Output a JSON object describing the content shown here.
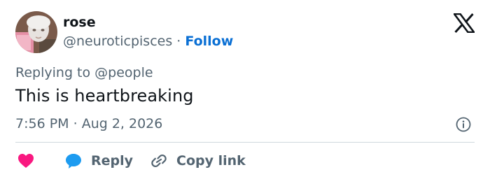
{
  "author": {
    "name": "rose",
    "handle": "@neuroticpisces",
    "separator": "·",
    "follow_label": "Follow"
  },
  "reply": {
    "prefix": "Replying to",
    "mention": "@people"
  },
  "tweet": {
    "text": "This is heartbreaking",
    "time": "7:56 PM",
    "date": "Aug 2, 2026"
  },
  "actions": {
    "reply_label": "Reply",
    "copy_label": "Copy link"
  },
  "icons": {
    "brand": "x-logo-icon",
    "info": "info-icon",
    "like": "heart-icon",
    "reply": "speech-bubble-icon",
    "copy": "link-icon"
  },
  "colors": {
    "like": "#f91880",
    "reply": "#1d9bf0",
    "follow": "#0a6fd4",
    "secondary_text": "#536471"
  }
}
